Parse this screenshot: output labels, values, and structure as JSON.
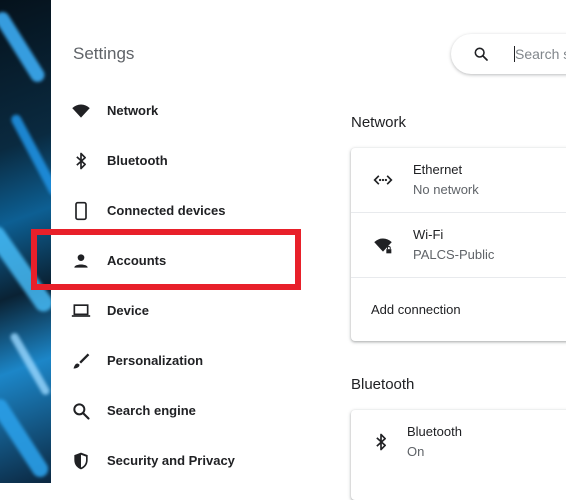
{
  "settings_title": "Settings",
  "search": {
    "placeholder": "Search settings",
    "icon": "search-icon"
  },
  "sidebar": {
    "items": [
      {
        "label": "Network",
        "icon": "wifi-icon"
      },
      {
        "label": "Bluetooth",
        "icon": "bluetooth-icon"
      },
      {
        "label": "Connected devices",
        "icon": "phone-icon"
      },
      {
        "label": "Accounts",
        "icon": "person-icon"
      },
      {
        "label": "Device",
        "icon": "laptop-icon"
      },
      {
        "label": "Personalization",
        "icon": "brush-icon"
      },
      {
        "label": "Search engine",
        "icon": "search-icon"
      },
      {
        "label": "Security and Privacy",
        "icon": "shield-icon"
      }
    ]
  },
  "network_section": {
    "title": "Network",
    "ethernet": {
      "label": "Ethernet",
      "status": "No network",
      "icon": "ethernet-icon"
    },
    "wifi": {
      "label": "Wi-Fi",
      "status": "PALCS-Public",
      "icon": "wifi-lock-icon"
    },
    "add_connection": "Add connection"
  },
  "bluetooth_section": {
    "title": "Bluetooth",
    "bluetooth": {
      "label": "Bluetooth",
      "status": "On",
      "icon": "bluetooth-icon"
    }
  },
  "colors": {
    "highlight": "#e8202a",
    "text": "#202124",
    "secondary_text": "#5f6368"
  }
}
